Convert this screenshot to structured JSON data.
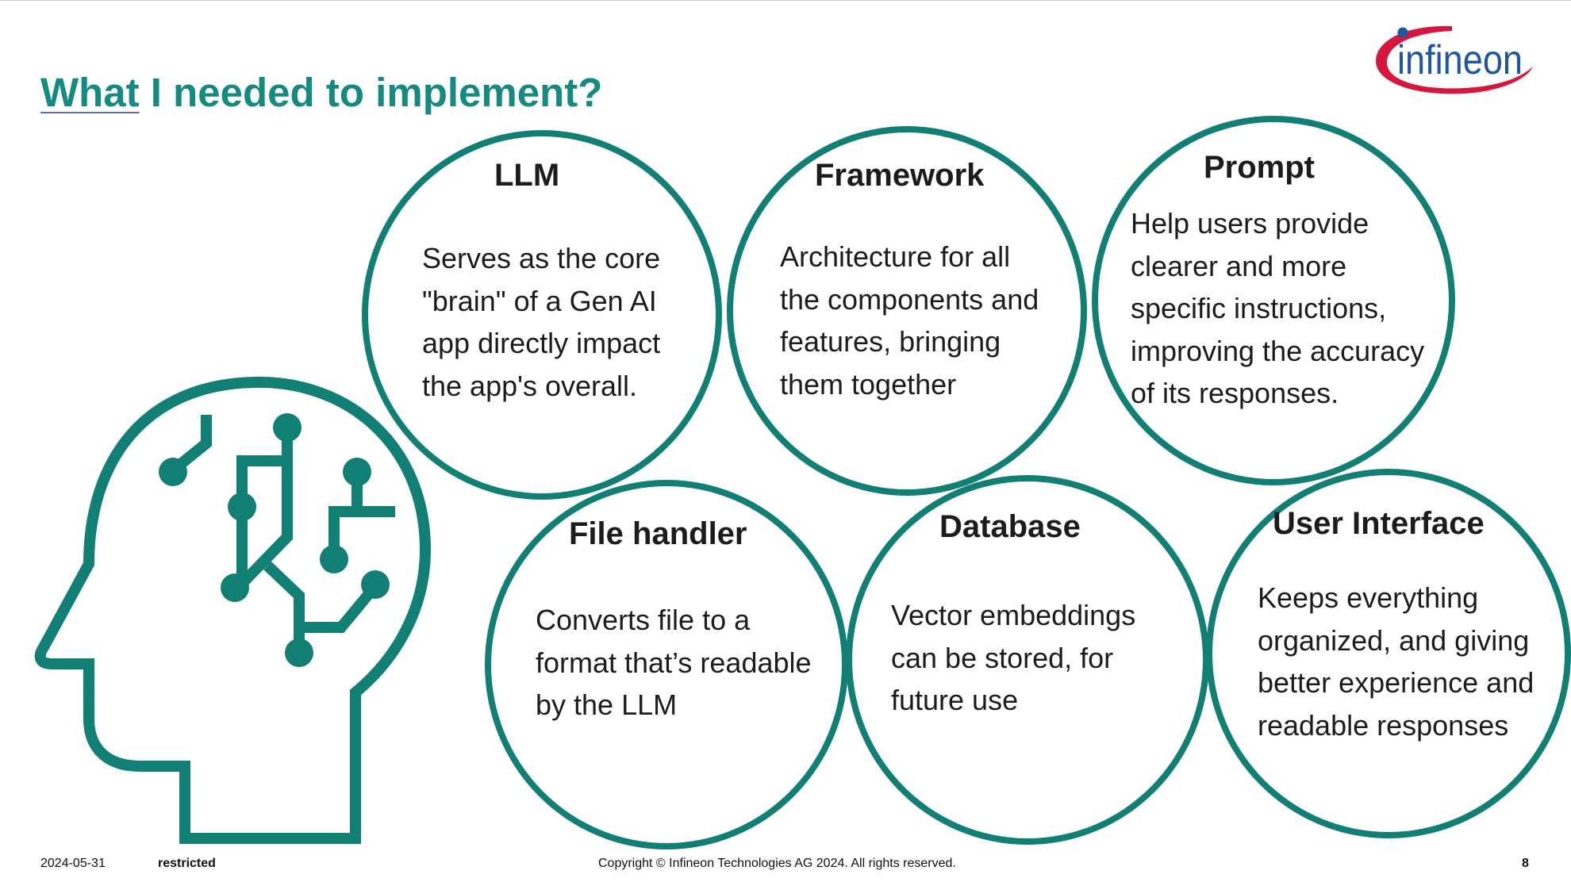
{
  "slide": {
    "title_first_word": "What",
    "title_rest": " I needed to implement?",
    "logo_text": "infineon"
  },
  "colors": {
    "accent": "#158a7e",
    "circle_stroke": "#127f74",
    "logo_blue": "#1f55a5",
    "logo_red": "#d6173d",
    "text": "#1c1c1c"
  },
  "icons": [
    "head-circuit-icon",
    "infineon-logo"
  ],
  "circles": [
    {
      "title": "LLM",
      "lines": [
        "Serves as the core",
        "\"brain\" of a Gen AI",
        "app directly impact",
        "the app's overall."
      ]
    },
    {
      "title": "Framework",
      "lines": [
        "Architecture for all",
        "the components and",
        "features, bringing",
        "them together"
      ]
    },
    {
      "title": "Prompt",
      "lines": [
        "Help users provide",
        "clearer and more",
        "specific instructions,",
        "improving the accuracy",
        "of its responses."
      ]
    },
    {
      "title": "File handler",
      "lines": [
        "Converts file to a",
        "format that’s readable",
        "by the LLM"
      ]
    },
    {
      "title": "Database",
      "lines": [
        "Vector embeddings",
        "can be stored, for",
        "future use"
      ]
    },
    {
      "title": "User Interface",
      "lines": [
        "Keeps everything",
        "organized, and giving",
        "better experience and",
        "readable responses"
      ]
    }
  ],
  "footer": {
    "date": "2024-05-31",
    "classification": "restricted",
    "copyright": "Copyright © Infineon Technologies AG 2024. All rights reserved.",
    "page_number": "8"
  }
}
